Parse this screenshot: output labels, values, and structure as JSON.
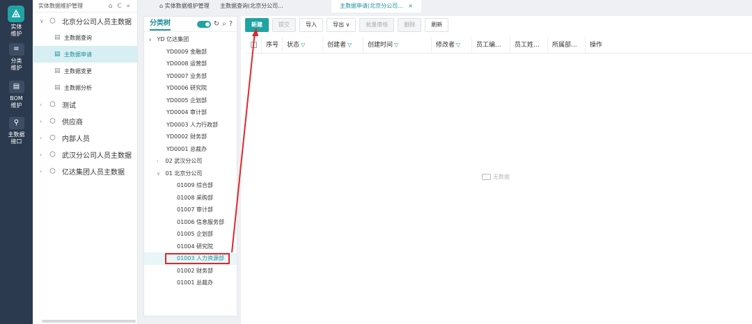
{
  "rail": {
    "items": [
      {
        "label": "实体\n维护",
        "icon": "cube-icon"
      },
      {
        "label": "分类\n维护",
        "icon": "list-icon"
      },
      {
        "label": "BOM\n维护",
        "icon": "doc-icon"
      },
      {
        "label": "主数据\n接口",
        "icon": "plug-icon"
      }
    ]
  },
  "nav": {
    "header": "实体数据维护管理",
    "tools": "⌂ C «",
    "groups": [
      {
        "label": "北京分公司人员主数据",
        "expanded": true
      },
      {
        "label": "测试"
      },
      {
        "label": "供应商"
      },
      {
        "label": "内部人员"
      },
      {
        "label": "武汉分公司人员主数据"
      },
      {
        "label": "亿达集团人员主数据"
      }
    ],
    "subitems": [
      "主数据查询",
      "主数据申请",
      "主数据变更",
      "主数据分析"
    ]
  },
  "tabs": {
    "t1": "实体数据维护管理",
    "t2": "主数据查询(北京分公司...",
    "t3": "主数据申请(北京分公司...",
    "close": "×"
  },
  "tree": {
    "title": "分类树",
    "root": "YD 亿达集团",
    "yd_children": [
      "YD0009 金融部",
      "YD0008 运营部",
      "YD0007 业务部",
      "YD0006 研究院",
      "YD0005 企划部",
      "YD0004 审计部",
      "YD0003 人力行政部",
      "YD0002 财务部",
      "YD0001 总裁办"
    ],
    "branch02": "02 武汉分公司",
    "branch01": "01 北京分公司",
    "bj_children": [
      "01009 综合部",
      "01008 采购部",
      "01007 审计部",
      "01006 信息服务部",
      "01005 企划部",
      "01004 研究院",
      "01003 人力资源部",
      "01002 财务部",
      "01001 总裁办"
    ],
    "selected": "01003 人力资源部"
  },
  "toolbar": {
    "new": "新建",
    "submit": "提交",
    "import": "导入",
    "export": "导出",
    "batch_approve": "批量审核",
    "delete": "删除",
    "refresh": "刷新"
  },
  "table": {
    "columns": [
      "序号",
      "状态",
      "创建者",
      "创建时间",
      "修改者",
      "员工编...",
      "员工姓...",
      "所属部...",
      "操作"
    ],
    "empty": "无数据"
  },
  "colors": {
    "accent": "#1fa3a3",
    "rail": "#2b3a4e",
    "highlight": "#e0262a"
  }
}
